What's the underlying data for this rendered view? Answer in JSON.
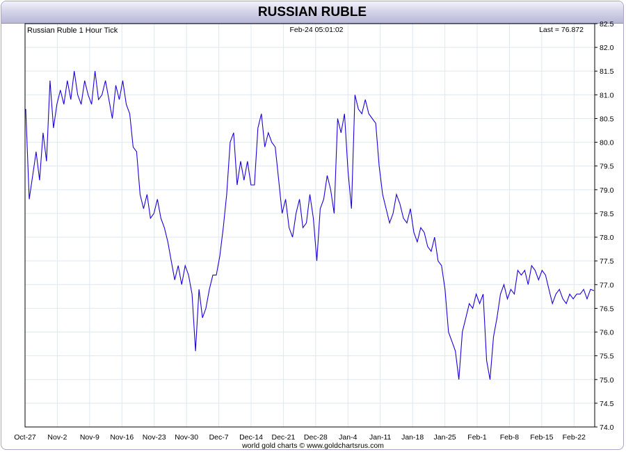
{
  "header": {
    "title": "RUSSIAN RUBLE"
  },
  "info": {
    "series_label": "Russian Ruble 1 Hour Tick",
    "timestamp": "Feb-24  05:01:02",
    "last_label": "Last = 76.872"
  },
  "footer": {
    "credit": "world gold charts © www.goldchartsrus.com"
  },
  "colors": {
    "line": "#1a00d9",
    "grid": "#dde8f0",
    "frame": "#a6a6c4"
  },
  "chart_data": {
    "type": "line",
    "title": "RUSSIAN RUBLE",
    "xlabel": "",
    "ylabel": "",
    "ylim": [
      74.0,
      82.5
    ],
    "grid": true,
    "y_ticks": [
      "82.5",
      "82.0",
      "81.5",
      "81.0",
      "80.5",
      "80.0",
      "79.5",
      "79.0",
      "78.5",
      "78.0",
      "77.5",
      "77.0",
      "76.5",
      "76.0",
      "75.5",
      "75.0",
      "74.5",
      "74.0"
    ],
    "x_ticks": [
      "Oct-27",
      "Nov-2",
      "Nov-9",
      "Nov-16",
      "Nov-23",
      "Nov-30",
      "Dec-7",
      "Dec-14",
      "Dec-21",
      "Dec-28",
      "Jan-4",
      "Jan-11",
      "Jan-18",
      "Jan-25",
      "Feb-1",
      "Feb-8",
      "Feb-15",
      "Feb-22"
    ],
    "series": [
      {
        "values": [
          80.7,
          78.8,
          79.3,
          79.8,
          79.2,
          80.2,
          79.6,
          81.3,
          80.3,
          80.8,
          81.1,
          80.8,
          81.3,
          80.9,
          81.5,
          81.0,
          80.8,
          81.3,
          81.0,
          80.8,
          81.5,
          80.9,
          81.0,
          81.3,
          80.9,
          80.5,
          81.2,
          80.9,
          81.3,
          80.8,
          80.6,
          79.9,
          79.8,
          78.9,
          78.6,
          78.9,
          78.4,
          78.5,
          78.8,
          78.4,
          78.2,
          77.9,
          77.5,
          77.1,
          77.4,
          77.0,
          77.4,
          77.2,
          76.8,
          75.6,
          76.9,
          76.3,
          76.5,
          76.9,
          77.2,
          77.2,
          77.6,
          78.2,
          78.9,
          80.0,
          80.2,
          79.1,
          79.6,
          79.2,
          79.6,
          79.1,
          79.1,
          80.3,
          80.6,
          79.9,
          80.2,
          80.0,
          79.9,
          79.2,
          78.5,
          78.8,
          78.2,
          78.0,
          78.5,
          78.8,
          78.2,
          78.3,
          78.9,
          78.4,
          77.5,
          78.6,
          78.8,
          79.3,
          79.0,
          78.5,
          80.5,
          80.2,
          80.6,
          79.4,
          78.6,
          81.0,
          80.7,
          80.6,
          80.9,
          80.6,
          80.5,
          80.4,
          79.5,
          78.9,
          78.6,
          78.3,
          78.5,
          78.9,
          78.7,
          78.4,
          78.3,
          78.6,
          78.1,
          77.9,
          78.2,
          78.1,
          77.8,
          77.7,
          78.0,
          77.5,
          77.4,
          76.9,
          76.0,
          75.8,
          75.6,
          75.0,
          76.0,
          76.3,
          76.6,
          76.5,
          76.8,
          76.6,
          76.8,
          75.4,
          75.0,
          75.9,
          76.3,
          76.8,
          77.0,
          76.7,
          76.9,
          76.8,
          77.3,
          77.2,
          77.3,
          77.0,
          77.4,
          77.3,
          77.1,
          77.3,
          77.2,
          76.9,
          76.6,
          76.8,
          76.9,
          76.7,
          76.6,
          76.8,
          76.7,
          76.8,
          76.8,
          76.9,
          76.7,
          76.9,
          76.872
        ]
      }
    ]
  }
}
